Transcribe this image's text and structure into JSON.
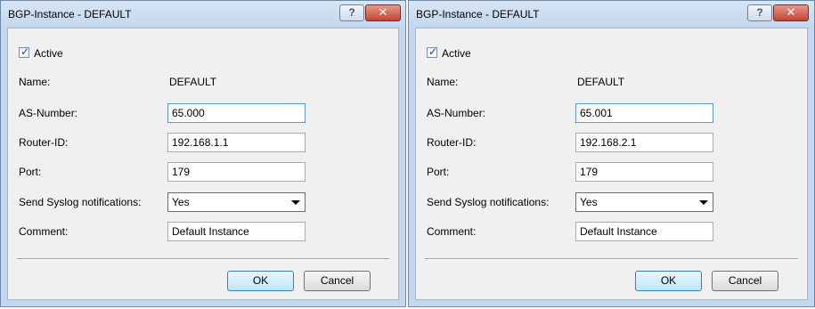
{
  "dialogs": [
    {
      "title": "BGP-Instance - DEFAULT",
      "help_glyph": "?",
      "close_glyph": "✕",
      "active": {
        "label": "Active",
        "checked": true
      },
      "name": {
        "label": "Name:",
        "value": "DEFAULT"
      },
      "as_number": {
        "label": "AS-Number:",
        "value": "65.000"
      },
      "router_id": {
        "label": "Router-ID:",
        "value": "192.168.1.1"
      },
      "port": {
        "label": "Port:",
        "value": "179"
      },
      "syslog": {
        "label": "Send Syslog notifications:",
        "value": "Yes"
      },
      "comment": {
        "label": "Comment:",
        "value": "Default Instance"
      },
      "ok_label": "OK",
      "cancel_label": "Cancel"
    },
    {
      "title": "BGP-Instance - DEFAULT",
      "help_glyph": "?",
      "close_glyph": "✕",
      "active": {
        "label": "Active",
        "checked": true
      },
      "name": {
        "label": "Name:",
        "value": "DEFAULT"
      },
      "as_number": {
        "label": "AS-Number:",
        "value": "65.001"
      },
      "router_id": {
        "label": "Router-ID:",
        "value": "192.168.2.1"
      },
      "port": {
        "label": "Port:",
        "value": "179"
      },
      "syslog": {
        "label": "Send Syslog notifications:",
        "value": "Yes"
      },
      "comment": {
        "label": "Comment:",
        "value": "Default Instance"
      },
      "ok_label": "OK",
      "cancel_label": "Cancel"
    }
  ],
  "colors": {
    "window_frame": "#c4d7ee",
    "dialog_body": "#f0f0f0",
    "close_button": "#c44432",
    "focus_border": "#5b9bd5"
  },
  "icons": {
    "help": "help-icon",
    "close": "close-icon",
    "dropdown": "chevron-down-icon",
    "checkbox": "checkmark-icon"
  }
}
